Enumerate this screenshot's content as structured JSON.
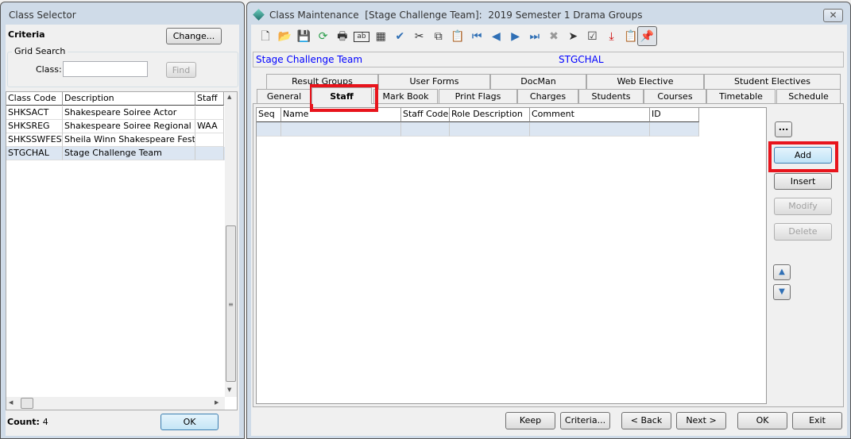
{
  "selector": {
    "title": "Class Selector",
    "criteria_label": "Criteria",
    "change_button": "Change...",
    "grid_search_label": "Grid Search",
    "class_label": "Class:",
    "class_value": "",
    "find_button": "Find",
    "columns": [
      "Class Code",
      "Description",
      "Staff"
    ],
    "rows": [
      [
        "SHKSACT",
        "Shakespeare Soiree Actor",
        ""
      ],
      [
        "SHKSREG",
        "Shakespeare Soiree Regional",
        "WAA"
      ],
      [
        "SHKSSWFEST",
        "Sheila Winn Shakespeare Festival",
        ""
      ],
      [
        "STGCHAL",
        "Stage Challenge Team",
        ""
      ]
    ],
    "selected_row": 3,
    "count_label": "Count:",
    "count_value": "4",
    "ok_button": "OK"
  },
  "main": {
    "title": "Class Maintenance  [Stage Challenge Team]:  2019 Semester 1 Drama Groups",
    "toolbar": [
      "new-icon",
      "open-folder-icon",
      "save-icon",
      "refresh-icon",
      "print-icon",
      "text-field-icon",
      "calculator-icon",
      "spellcheck-icon",
      "cut-icon",
      "copy-icon",
      "paste-icon",
      "first-record-icon",
      "previous-record-icon",
      "next-record-icon",
      "last-record-icon",
      "delete-icon",
      "wizard-icon",
      "approve-icon",
      "download-icon",
      "clipboard-check-icon",
      "pin-icon"
    ],
    "class_name": "Stage Challenge Team",
    "class_code": "STGCHAL",
    "tabs_row1": [
      "Result Groups",
      "User Forms",
      "DocMan",
      "Web Elective",
      "Student Electives"
    ],
    "tabs_row2": [
      "General",
      "Staff",
      "Mark Book",
      "Print Flags",
      "Charges",
      "Students",
      "Courses",
      "Timetable",
      "Schedule"
    ],
    "active_tab": "Staff",
    "grid_columns": [
      "Seq",
      "Name",
      "Staff Code",
      "Role Description",
      "Comment",
      "ID"
    ],
    "side_buttons": {
      "ellipsis": "...",
      "add": "Add",
      "insert": "Insert",
      "modify": "Modify",
      "delete": "Delete"
    },
    "bottom_buttons": {
      "keep": "Keep",
      "criteria": "Criteria...",
      "back": "< Back",
      "next": "Next >",
      "ok": "OK",
      "exit": "Exit"
    },
    "colors": {
      "highlight": "#e8141c",
      "link_text": "#0000ff",
      "selected_row": "#dce6f2"
    }
  }
}
